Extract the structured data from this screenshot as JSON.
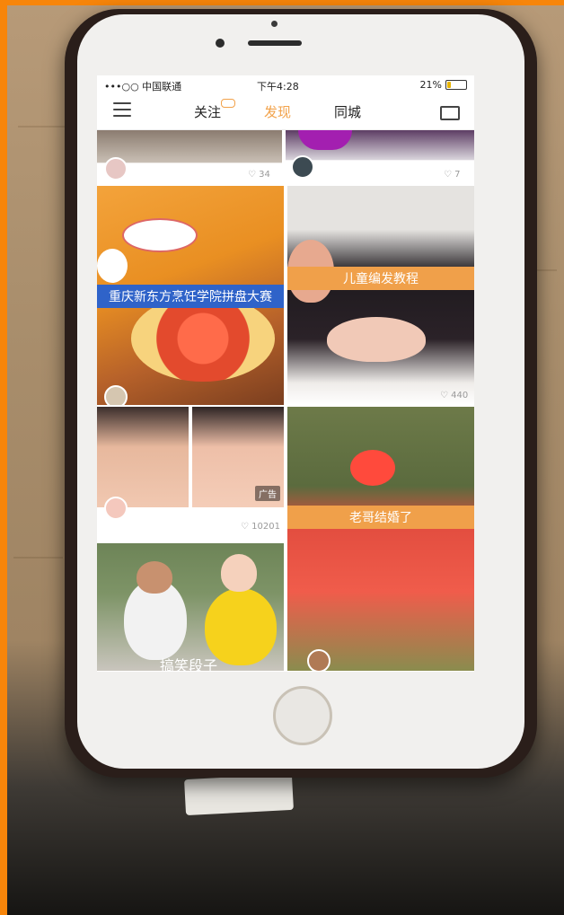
{
  "status_bar": {
    "carrier": "•••○○ 中国联通",
    "time": "下午4:28",
    "battery": "21%",
    "battery_level": 0.21
  },
  "nav": {
    "tabs": [
      {
        "label": "关注"
      },
      {
        "label": "发现",
        "active": true
      },
      {
        "label": "同城"
      }
    ]
  },
  "feed": {
    "top_left_likes": "34",
    "top_right_likes": "7",
    "food_title": "重庆新东方烹饪学院拼盘大赛",
    "braid_title": "儿童编发教程",
    "braid_likes": "440",
    "ad_label": "广告",
    "ad_likes": "10201",
    "wedding_title": "老哥结婚了",
    "comedy_title": "搞笑段子"
  },
  "colors": {
    "accent": "#f2a24a",
    "banner_orange": "#f0a04a",
    "banner_blue": "#2f63c9"
  }
}
